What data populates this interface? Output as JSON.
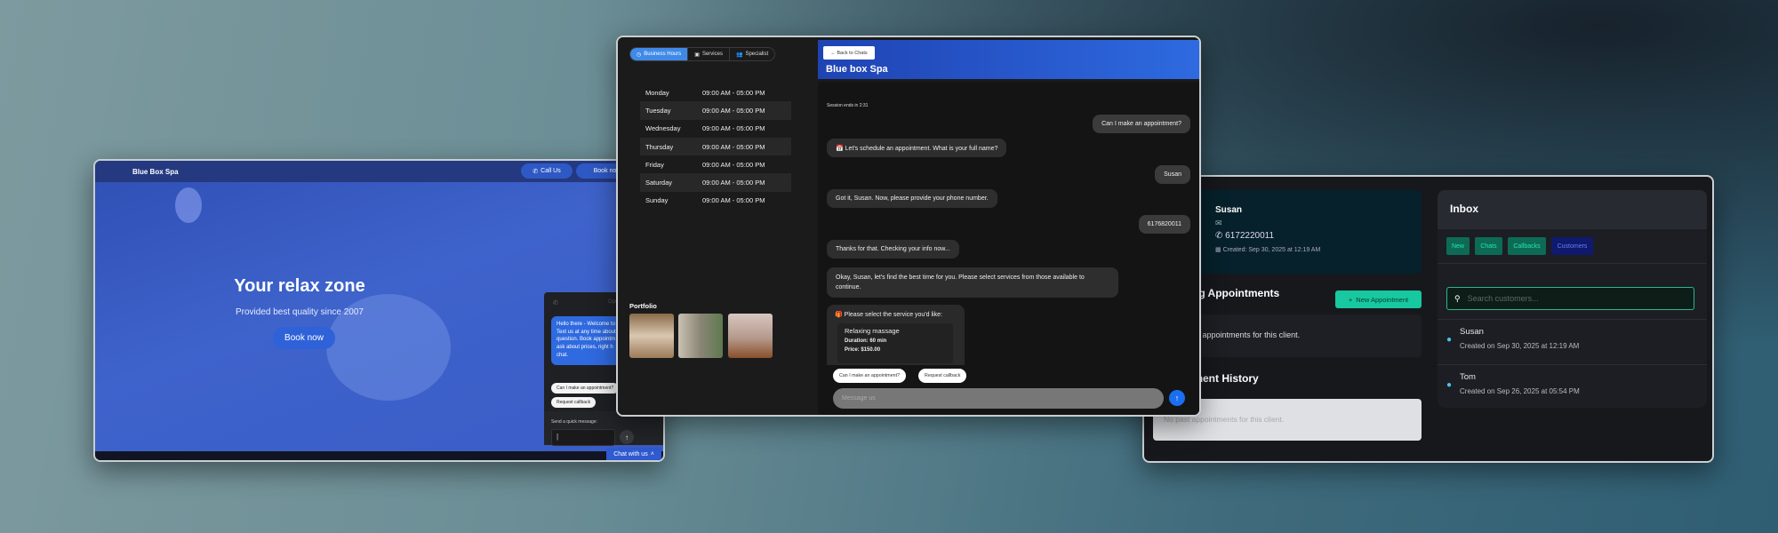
{
  "landing": {
    "brand": "Blue Box Spa",
    "call_us": "Call Us",
    "book_now_nav": "Book now",
    "hero_title": "Your relax zone",
    "hero_subtitle": "Provided best quality since 2007",
    "hero_button": "Book now",
    "widget": {
      "status": "Open",
      "welcome": "Hello there - Welcome to\nText us at any time about\nquestion. Book appointm\nask about prices, right h\nchat.",
      "quick_replies": [
        "Can I make an appointment?",
        "Request callback"
      ],
      "quick_message_label": "Send a quick message:",
      "input_value": "|"
    },
    "chat_with_us": "Chat with us"
  },
  "business": {
    "tabs": [
      {
        "label": "Business Hours",
        "icon": "clock-icon",
        "active": true
      },
      {
        "label": "Services",
        "icon": "briefcase-icon",
        "active": false
      },
      {
        "label": "Specialist",
        "icon": "users-icon",
        "active": false
      }
    ],
    "hours": [
      {
        "day": "Monday",
        "time": "09:00 AM - 05:00 PM"
      },
      {
        "day": "Tuesday",
        "time": "09:00 AM - 05:00 PM"
      },
      {
        "day": "Wednesday",
        "time": "09:00 AM - 05:00 PM"
      },
      {
        "day": "Thursday",
        "time": "09:00 AM - 05:00 PM"
      },
      {
        "day": "Friday",
        "time": "09:00 AM - 05:00 PM"
      },
      {
        "day": "Saturday",
        "time": "09:00 AM - 05:00 PM"
      },
      {
        "day": "Sunday",
        "time": "09:00 AM - 05:00 PM"
      }
    ],
    "portfolio_label": "Portfolio"
  },
  "chat": {
    "back_label": "← Back to Chats",
    "title": "Blue box Spa",
    "session": "Session ends in 2:31",
    "messages": [
      {
        "from": "user",
        "text": "Can I make an appointment?"
      },
      {
        "from": "bot",
        "text": "📅 Let's schedule an appointment. What is your full name?"
      },
      {
        "from": "user",
        "text": "Susan"
      },
      {
        "from": "bot",
        "text": "Got it, Susan. Now, please provide your phone number."
      },
      {
        "from": "user",
        "text": "6176820011"
      },
      {
        "from": "bot",
        "text": "Thanks for that. Checking your info now..."
      },
      {
        "from": "bot",
        "text": "Okay, Susan, let's find the best time for you. Please select services from those available to continue."
      }
    ],
    "service_prompt": "🎁 Please select the service you'd like:",
    "service": {
      "name": "Relaxing massage",
      "duration": "Duration: 60 min",
      "price": "Price: $150.00"
    },
    "quick_replies": [
      "Can I make an appointment?",
      "Request callback"
    ],
    "input_placeholder": "Message us"
  },
  "admin": {
    "client": {
      "name": "Susan",
      "phone": "6172220011",
      "created": "Created: Sep 30, 2025 at 12:19 AM"
    },
    "appointments_heading": "Upcoming Appointments",
    "new_appointment": "New Appointment",
    "no_upcoming": "No upcoming appointments for this client.",
    "history_heading": "Appointment History",
    "no_past": "No past appointments for this client.",
    "inbox": {
      "title": "Inbox",
      "tabs": [
        "New",
        "Chats",
        "Callbacks",
        "Customers"
      ],
      "active_tab": "Customers",
      "search_placeholder": "Search customers...",
      "customers": [
        {
          "name": "Susan",
          "created": "Created on Sep 30, 2025 at 12:19 AM"
        },
        {
          "name": "Tom",
          "created": "Created on Sep 26, 2025 at 05:54 PM"
        }
      ]
    }
  },
  "colors": {
    "accent_blue": "#2f6ae0",
    "teal": "#17c8a0",
    "dark_bg": "#141414"
  }
}
